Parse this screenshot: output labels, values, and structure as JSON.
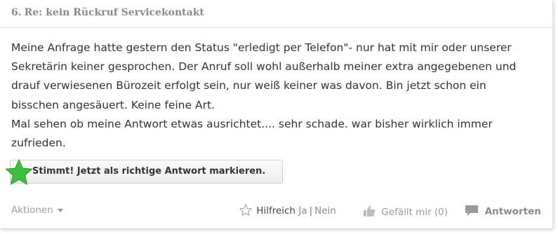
{
  "post": {
    "number": "6.",
    "title": "Re: kein Rückruf Servicekontakt",
    "body_lines": [
      "Meine Anfrage hatte gestern den Status \"erledigt per Telefon\"- nur hat mit mir oder unserer",
      "Sekretärin keiner gesprochen. Der Anruf soll wohl außerhalb meiner extra angegebenen und",
      "drauf verwiesenen Bürozeit erfolgt sein, nur weiß keiner was davon. Bin jetzt schon ein",
      "bisschen angesäuert. Keine feine Art.",
      "Mal sehen ob meine Antwort etwas ausrichtet.... sehr schade. war bisher wirklich immer",
      "zufrieden."
    ]
  },
  "accept_button": {
    "label": "Stimmt! Jetzt als richtige Antwort markieren.",
    "icon": "star-icon"
  },
  "footer": {
    "actions_label": "Aktionen",
    "helpful_label": "Hilfreich",
    "helpful_yes": "Ja",
    "helpful_sep": "|",
    "helpful_no": "Nein",
    "like_label": "Gefällt mir (0)",
    "reply_label": "Antworten"
  },
  "colors": {
    "accent_green": "#3fbf3f",
    "text": "#333333",
    "muted": "#8a8a8a"
  }
}
